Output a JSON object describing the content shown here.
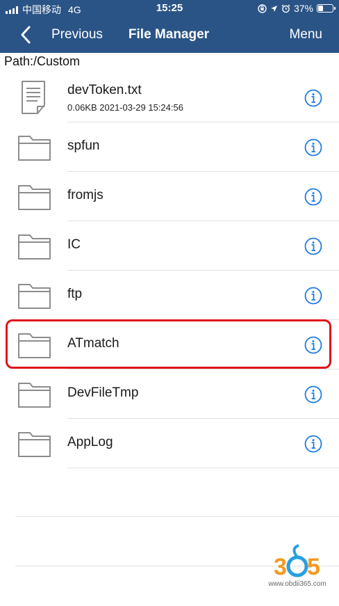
{
  "status_bar": {
    "carrier": "中国移动",
    "network": "4G",
    "time": "15:25",
    "battery_percent": "37%",
    "battery_level": 0.37
  },
  "nav": {
    "back_label": "Previous",
    "title": "File Manager",
    "menu_label": "Menu"
  },
  "path": "Path:/Custom",
  "files": [
    {
      "name": "devToken.txt",
      "type": "file",
      "meta": "0.06KB 2021-03-29 15:24:56"
    },
    {
      "name": "spfun",
      "type": "folder"
    },
    {
      "name": "fromjs",
      "type": "folder"
    },
    {
      "name": "IC",
      "type": "folder"
    },
    {
      "name": "ftp",
      "type": "folder"
    },
    {
      "name": "ATmatch",
      "type": "folder",
      "highlighted": true
    },
    {
      "name": "DevFileTmp",
      "type": "folder"
    },
    {
      "name": "AppLog",
      "type": "folder"
    }
  ],
  "watermark": {
    "logo": "365",
    "url": "www.obdii365.com"
  },
  "colors": {
    "header": "#2a5486",
    "info_icon": "#1e7be0",
    "highlight": "#e0141b",
    "folder_stroke": "#8c8c8c"
  }
}
